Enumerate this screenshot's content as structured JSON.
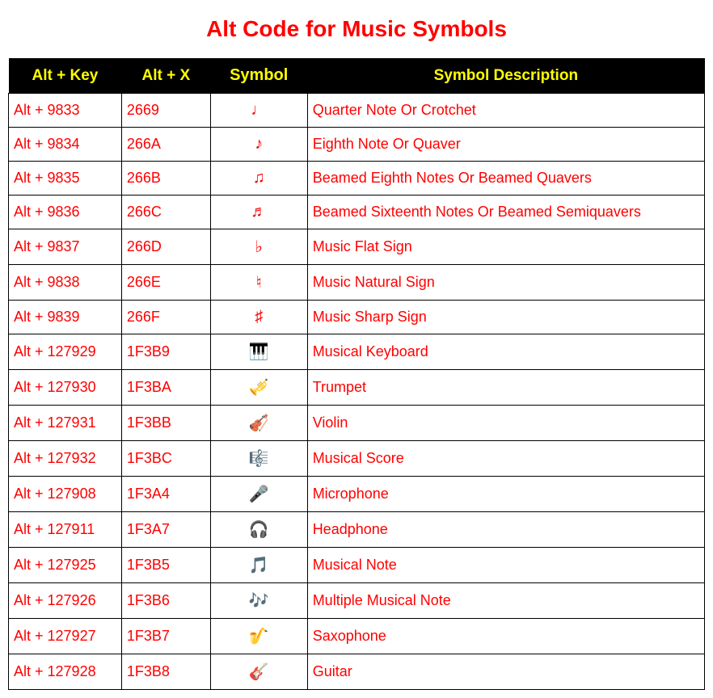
{
  "title": "Alt Code for Music Symbols",
  "columns": {
    "altKey": "Alt + Key",
    "altX": "Alt + X",
    "symbol": "Symbol",
    "description": "Symbol Description"
  },
  "rows": [
    {
      "altKey": "Alt + 9833",
      "altX": "2669",
      "symbol": "♩",
      "description": "Quarter Note Or Crotchet"
    },
    {
      "altKey": "Alt + 9834",
      "altX": "266A",
      "symbol": "♪",
      "description": "Eighth Note Or Quaver"
    },
    {
      "altKey": "Alt + 9835",
      "altX": "266B",
      "symbol": "♫",
      "description": "Beamed Eighth Notes Or Beamed Quavers"
    },
    {
      "altKey": "Alt + 9836",
      "altX": "266C",
      "symbol": "♬",
      "description": "Beamed Sixteenth Notes Or Beamed Semiquavers"
    },
    {
      "altKey": "Alt + 9837",
      "altX": "266D",
      "symbol": "♭",
      "description": "Music Flat Sign"
    },
    {
      "altKey": "Alt + 9838",
      "altX": "266E",
      "symbol": "♮",
      "description": "Music Natural Sign"
    },
    {
      "altKey": "Alt + 9839",
      "altX": "266F",
      "symbol": "♯",
      "description": "Music Sharp Sign"
    },
    {
      "altKey": "Alt + 127929",
      "altX": "1F3B9",
      "symbol": "🎹",
      "description": "Musical Keyboard"
    },
    {
      "altKey": "Alt + 127930",
      "altX": "1F3BA",
      "symbol": "🎺",
      "description": "Trumpet"
    },
    {
      "altKey": "Alt + 127931",
      "altX": "1F3BB",
      "symbol": "🎻",
      "description": "Violin"
    },
    {
      "altKey": "Alt + 127932",
      "altX": "1F3BC",
      "symbol": "🎼",
      "description": "Musical Score"
    },
    {
      "altKey": "Alt + 127908",
      "altX": "1F3A4",
      "symbol": "🎤",
      "description": "Microphone"
    },
    {
      "altKey": "Alt + 127911",
      "altX": "1F3A7",
      "symbol": "🎧",
      "description": "Headphone"
    },
    {
      "altKey": "Alt + 127925",
      "altX": "1F3B5",
      "symbol": "🎵",
      "description": "Musical Note"
    },
    {
      "altKey": "Alt + 127926",
      "altX": "1F3B6",
      "symbol": "🎶",
      "description": "Multiple Musical Note"
    },
    {
      "altKey": "Alt + 127927",
      "altX": "1F3B7",
      "symbol": "🎷",
      "description": "Saxophone"
    },
    {
      "altKey": "Alt + 127928",
      "altX": "1F3B8",
      "symbol": "🎸",
      "description": "Guitar"
    }
  ]
}
